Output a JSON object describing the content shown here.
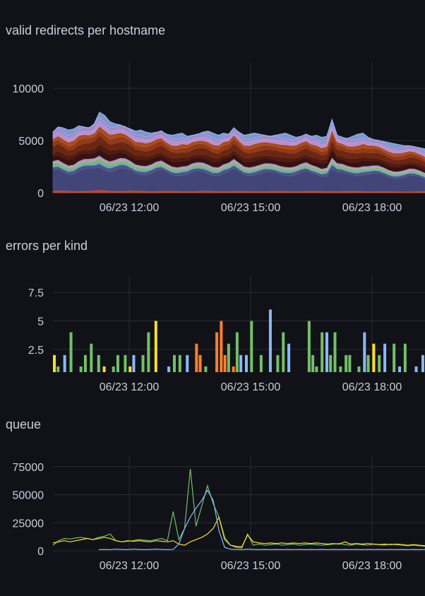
{
  "charts": [
    {
      "title": "valid redirects per hostname",
      "chart_data": {
        "type": "area",
        "stacked": true,
        "x_ticks": [
          "06/23 12:00",
          "06/23 15:00",
          "06/23 18:00"
        ],
        "y_ticks": [
          "0",
          "5000",
          "10000"
        ],
        "ylim": [
          0,
          12500
        ],
        "grid": true,
        "series_colors": [
          "#e0542c",
          "#4a4f8a",
          "#5b5f99",
          "#6ec6cf",
          "#9ccc65",
          "#c7b1e6",
          "#3b1410",
          "#5a1d12",
          "#7a2b14",
          "#a5421c",
          "#c2591f",
          "#d4a5f0",
          "#b9a3e8",
          "#8fb0ef"
        ],
        "stack_top_samples": [
          5800,
          6300,
          6200,
          6000,
          6100,
          6400,
          6300,
          6200,
          6600,
          7700,
          7400,
          6800,
          6600,
          6500,
          6300,
          6100,
          5900,
          6000,
          5800,
          5700,
          5800,
          5900,
          5600,
          5500,
          5600,
          5700,
          5400,
          5500,
          5600,
          5800,
          5900,
          5700,
          5500,
          5700,
          5600,
          6200,
          5800,
          5500,
          5600,
          5700,
          5600,
          5500,
          5400,
          5500,
          5600,
          5700,
          5500,
          5300,
          5400,
          5600,
          5400,
          5500,
          5300,
          5400,
          7000,
          5500,
          5300,
          5200,
          5400,
          5600,
          5700,
          5300,
          5100,
          5000,
          4900,
          4800,
          4700,
          4600,
          4500,
          4500,
          4400,
          4300,
          4200
        ]
      }
    },
    {
      "title": "errors per kind",
      "chart_data": {
        "type": "bar",
        "x_ticks": [
          "06/23 12:00",
          "06/23 15:00",
          "06/23 18:00"
        ],
        "y_ticks": [
          "2.5",
          "5",
          "7.5"
        ],
        "ylim": [
          0.5,
          9
        ],
        "grid": true,
        "bars": [
          {
            "t": 0.0,
            "v": 2,
            "c": "#fade2a"
          },
          {
            "t": 0.01,
            "v": 1,
            "c": "#73bf69"
          },
          {
            "t": 0.028,
            "v": 2,
            "c": "#8ab8ff"
          },
          {
            "t": 0.045,
            "v": 4,
            "c": "#73bf69"
          },
          {
            "t": 0.072,
            "v": 1,
            "c": "#73bf69"
          },
          {
            "t": 0.084,
            "v": 2,
            "c": "#73bf69"
          },
          {
            "t": 0.1,
            "v": 3,
            "c": "#73bf69"
          },
          {
            "t": 0.12,
            "v": 2,
            "c": "#73bf69"
          },
          {
            "t": 0.135,
            "v": 1,
            "c": "#fade2a"
          },
          {
            "t": 0.16,
            "v": 1,
            "c": "#73bf69"
          },
          {
            "t": 0.172,
            "v": 2,
            "c": "#73bf69"
          },
          {
            "t": 0.192,
            "v": 2,
            "c": "#73bf69"
          },
          {
            "t": 0.205,
            "v": 1,
            "c": "#fade2a"
          },
          {
            "t": 0.215,
            "v": 2,
            "c": "#8ab8ff"
          },
          {
            "t": 0.24,
            "v": 2,
            "c": "#73bf69"
          },
          {
            "t": 0.255,
            "v": 4,
            "c": "#73bf69"
          },
          {
            "t": 0.275,
            "v": 5,
            "c": "#fade2a"
          },
          {
            "t": 0.31,
            "v": 1,
            "c": "#8ab8ff"
          },
          {
            "t": 0.325,
            "v": 2,
            "c": "#73bf69"
          },
          {
            "t": 0.34,
            "v": 2,
            "c": "#73bf69"
          },
          {
            "t": 0.36,
            "v": 2,
            "c": "#8ab8ff"
          },
          {
            "t": 0.385,
            "v": 3,
            "c": "#ff7f30"
          },
          {
            "t": 0.395,
            "v": 2,
            "c": "#ff7f30"
          },
          {
            "t": 0.41,
            "v": 1,
            "c": "#73bf69"
          },
          {
            "t": 0.44,
            "v": 4,
            "c": "#ff7f30"
          },
          {
            "t": 0.452,
            "v": 5,
            "c": "#ff7f30"
          },
          {
            "t": 0.462,
            "v": 2,
            "c": "#ff7f30"
          },
          {
            "t": 0.472,
            "v": 3,
            "c": "#73bf69"
          },
          {
            "t": 0.485,
            "v": 1,
            "c": "#ff7f30"
          },
          {
            "t": 0.495,
            "v": 4,
            "c": "#73bf69"
          },
          {
            "t": 0.505,
            "v": 2,
            "c": "#8ab8ff"
          },
          {
            "t": 0.52,
            "v": 2,
            "c": "#8ab8ff"
          },
          {
            "t": 0.534,
            "v": 5,
            "c": "#73bf69"
          },
          {
            "t": 0.56,
            "v": 2,
            "c": "#73bf69"
          },
          {
            "t": 0.585,
            "v": 6,
            "c": "#8ab8ff"
          },
          {
            "t": 0.605,
            "v": 2,
            "c": "#73bf69"
          },
          {
            "t": 0.62,
            "v": 4,
            "c": "#73bf69"
          },
          {
            "t": 0.635,
            "v": 3,
            "c": "#8ab8ff"
          },
          {
            "t": 0.69,
            "v": 5,
            "c": "#73bf69"
          },
          {
            "t": 0.7,
            "v": 2,
            "c": "#73bf69"
          },
          {
            "t": 0.71,
            "v": 1,
            "c": "#73bf69"
          },
          {
            "t": 0.725,
            "v": 4,
            "c": "#73bf69"
          },
          {
            "t": 0.738,
            "v": 4,
            "c": "#8ab8ff"
          },
          {
            "t": 0.748,
            "v": 2,
            "c": "#73bf69"
          },
          {
            "t": 0.76,
            "v": 4,
            "c": "#73bf69"
          },
          {
            "t": 0.775,
            "v": 1,
            "c": "#73bf69"
          },
          {
            "t": 0.79,
            "v": 2,
            "c": "#73bf69"
          },
          {
            "t": 0.8,
            "v": 2,
            "c": "#73bf69"
          },
          {
            "t": 0.825,
            "v": 1,
            "c": "#73bf69"
          },
          {
            "t": 0.84,
            "v": 4,
            "c": "#8ab8ff"
          },
          {
            "t": 0.85,
            "v": 2,
            "c": "#73bf69"
          },
          {
            "t": 0.865,
            "v": 3,
            "c": "#fade2a"
          },
          {
            "t": 0.88,
            "v": 2,
            "c": "#73bf69"
          },
          {
            "t": 0.895,
            "v": 3,
            "c": "#8ab8ff"
          },
          {
            "t": 0.92,
            "v": 3,
            "c": "#73bf69"
          },
          {
            "t": 0.935,
            "v": 1,
            "c": "#8ab8ff"
          },
          {
            "t": 0.95,
            "v": 3,
            "c": "#73bf69"
          },
          {
            "t": 0.98,
            "v": 1,
            "c": "#8ab8ff"
          },
          {
            "t": 0.998,
            "v": 2,
            "c": "#8ab8ff"
          }
        ]
      }
    },
    {
      "title": "queue",
      "chart_data": {
        "type": "line",
        "x_ticks": [
          "06/23 12:00",
          "06/23 15:00",
          "06/23 18:00"
        ],
        "y_ticks": [
          "0",
          "25000",
          "50000",
          "75000"
        ],
        "ylim": [
          0,
          85000
        ],
        "grid": true,
        "series": [
          {
            "color": "#73bf69",
            "values": [
              5000,
              9000,
              11000,
              10500,
              11500,
              12000,
              11000,
              10000,
              12000,
              13000,
              15000,
              9000,
              8000,
              8500,
              9000,
              10000,
              9500,
              9000,
              10000,
              11000,
              9000,
              35000,
              10000,
              20000,
              73000,
              22000,
              40000,
              58000,
              42000,
              30000,
              12000,
              5000,
              3000,
              2500,
              15000,
              5000,
              6000,
              5000,
              5500,
              6000,
              5000,
              5500,
              6000,
              5000,
              5500,
              6000,
              5500,
              5000,
              5500,
              6000,
              6500,
              5500,
              5000,
              6000,
              5500,
              5000,
              6000,
              5500,
              5000,
              6000,
              5500,
              5000,
              4500,
              5000,
              4500,
              4000
            ]
          },
          {
            "color": "#fade2a",
            "values": [
              7000,
              8000,
              9000,
              8000,
              9000,
              10000,
              11000,
              10000,
              11000,
              12000,
              11000,
              9000,
              8000,
              9000,
              8500,
              9000,
              8500,
              8000,
              9000,
              8500,
              8000,
              9000,
              6000,
              5000,
              8000,
              10000,
              12000,
              15000,
              20000,
              30000,
              10000,
              5000,
              4000,
              3500,
              14000,
              8000,
              7000,
              6500,
              7000,
              6500,
              7000,
              6500,
              7000,
              6500,
              7000,
              6500,
              7000,
              6500,
              6000,
              6500,
              6000,
              8000,
              6000,
              6500,
              6000,
              6500,
              6000,
              5500,
              6000,
              5500,
              6000,
              5500,
              5000,
              5500,
              5000,
              4500
            ]
          },
          {
            "color": "#8ab8ff",
            "values": [
              null,
              null,
              null,
              null,
              null,
              null,
              null,
              null,
              1000,
              1200,
              1000,
              1500,
              1200,
              1000,
              1500,
              1200,
              1000,
              1200,
              1500,
              1200,
              1000,
              1200,
              6000,
              20000,
              30000,
              38000,
              45000,
              54000,
              45000,
              18000,
              3000,
              1500,
              1200,
              1000,
              1500,
              1200,
              1000,
              1200,
              1000,
              1200,
              1000,
              1200,
              1000,
              1200,
              1000,
              1200,
              1000,
              1200,
              1000,
              1200,
              1000,
              1200,
              1000,
              1200,
              1000,
              1200,
              1000,
              1200,
              1000,
              1200,
              1000,
              1200,
              1000,
              1200,
              1000,
              1200
            ]
          }
        ]
      }
    }
  ]
}
